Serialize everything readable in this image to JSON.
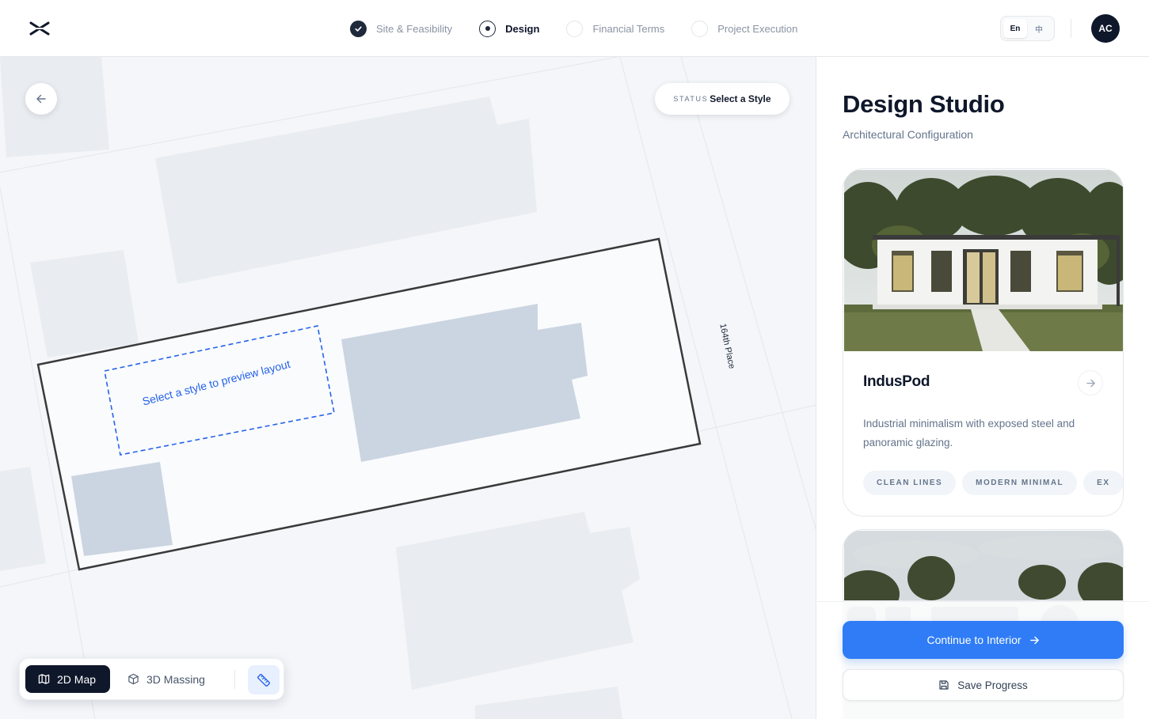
{
  "header": {
    "steps": [
      {
        "label": "Site & Feasibility",
        "state": "done"
      },
      {
        "label": "Design",
        "state": "current"
      },
      {
        "label": "Financial Terms",
        "state": "todo"
      },
      {
        "label": "Project Execution",
        "state": "todo"
      }
    ],
    "lang": {
      "en": "En",
      "zh": "中"
    },
    "avatar_initials": "AC"
  },
  "map": {
    "status_key": "STATUS",
    "status_value": "Select a Style",
    "street_label": "164th Place",
    "preview_prompt": "Select a style to preview layout",
    "toolbar": {
      "map2d": "2D Map",
      "massing3d": "3D Massing"
    }
  },
  "panel": {
    "title": "Design Studio",
    "subtitle": "Architectural Configuration",
    "styles": [
      {
        "name": "IndusPod",
        "description": "Industrial minimalism with exposed steel and panoramic glazing.",
        "tags": [
          "CLEAN LINES",
          "MODERN MINIMAL",
          "EX"
        ]
      }
    ],
    "continue_label": "Continue to Interior",
    "save_label": "Save Progress"
  },
  "colors": {
    "accent": "#2f7cf6",
    "dark": "#0f172a",
    "map_bg": "#f4f6f9",
    "building": "#cbd5e1",
    "preview_dash": "#2563eb"
  }
}
